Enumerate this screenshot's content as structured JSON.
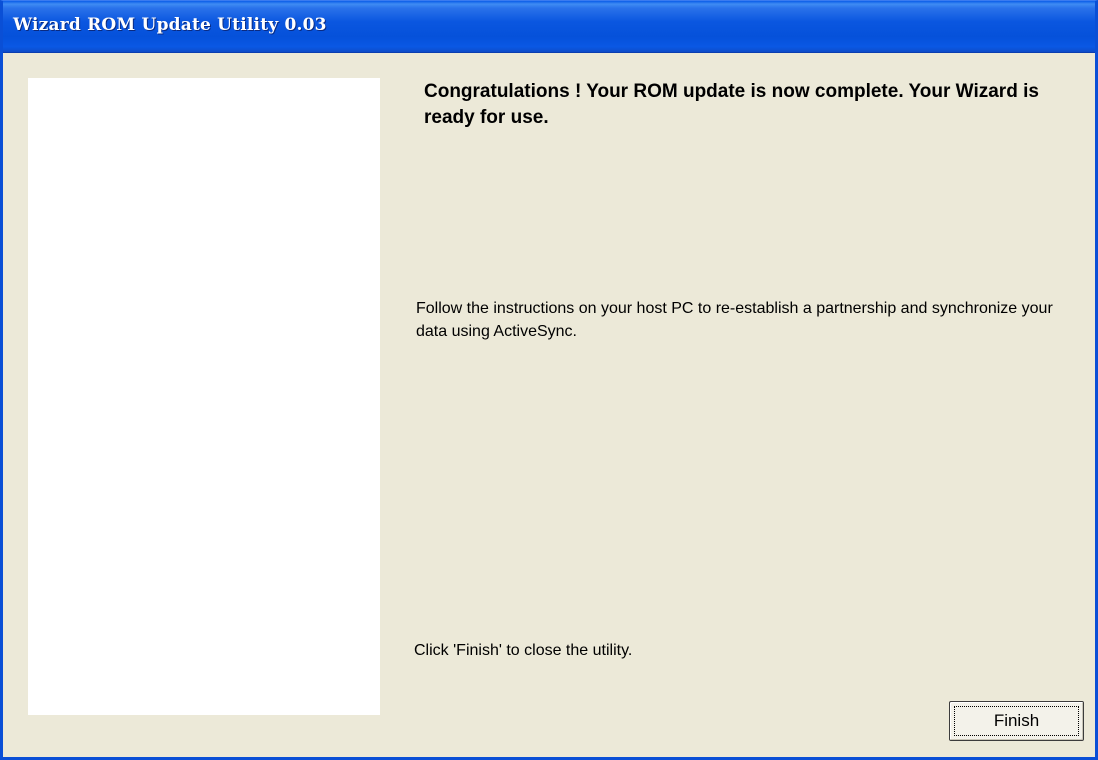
{
  "window": {
    "title": "Wizard ROM Update Utility 0.03"
  },
  "content": {
    "headline": "Congratulations ! Your ROM update is now complete. Your Wizard is ready for use.",
    "instructions": "Follow the instructions on your host PC to re-establish a partnership and synchronize your data using ActiveSync.",
    "finish_note": "Click 'Finish' to close the utility."
  },
  "buttons": {
    "finish_label": "Finish"
  },
  "colors": {
    "titlebar": "#0a5de8",
    "dialog_background": "#ece9d8",
    "side_panel": "#ffffff"
  }
}
